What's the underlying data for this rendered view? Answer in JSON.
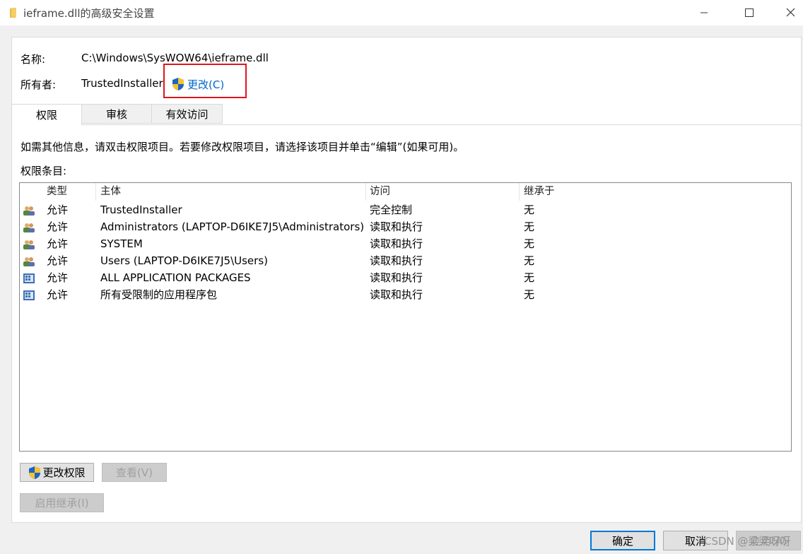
{
  "window": {
    "title": "ieframe.dll的高级安全设置",
    "icons": {
      "title": "folder-icon",
      "minimize": "minimize-icon",
      "maximize": "maximize-icon",
      "close": "close-icon"
    }
  },
  "object": {
    "name_label": "名称:",
    "name_value": "C:\\Windows\\SysWOW64\\ieframe.dll",
    "owner_label": "所有者:",
    "owner_value": "TrustedInstaller",
    "change_owner_label": "更改(C)",
    "change_owner_icon": "uac-shield-icon"
  },
  "tabs": [
    {
      "label": "权限",
      "active": true
    },
    {
      "label": "审核",
      "active": false
    },
    {
      "label": "有效访问",
      "active": false
    }
  ],
  "description": "如需其他信息，请双击权限项目。若要修改权限项目，请选择该项目并单击“编辑”(如果可用)。",
  "entries_label": "权限条目:",
  "table": {
    "columns": [
      "类型",
      "主体",
      "访问",
      "继承于"
    ],
    "rows": [
      {
        "icon": "user-group-icon",
        "type": "允许",
        "principal": "TrustedInstaller",
        "access": "完全控制",
        "inherited": "无"
      },
      {
        "icon": "user-group-icon",
        "type": "允许",
        "principal": "Administrators (LAPTOP-D6IKE7J5\\Administrators)",
        "access": "读取和执行",
        "inherited": "无"
      },
      {
        "icon": "user-group-icon",
        "type": "允许",
        "principal": "SYSTEM",
        "access": "读取和执行",
        "inherited": "无"
      },
      {
        "icon": "user-group-icon",
        "type": "允许",
        "principal": "Users (LAPTOP-D6IKE7J5\\Users)",
        "access": "读取和执行",
        "inherited": "无"
      },
      {
        "icon": "app-package-icon",
        "type": "允许",
        "principal": "ALL APPLICATION PACKAGES",
        "access": "读取和执行",
        "inherited": "无"
      },
      {
        "icon": "app-package-icon",
        "type": "允许",
        "principal": "所有受限制的应用程序包",
        "access": "读取和执行",
        "inherited": "无"
      }
    ]
  },
  "buttons": {
    "change_permissions": "更改权限",
    "view": "查看(V)",
    "enable_inheritance": "启用继承(I)",
    "ok": "确定",
    "cancel": "取消",
    "apply": "应用(A)"
  },
  "watermark": "CSDN @梁梁呀呀",
  "colors": {
    "link": "#0066cc",
    "highlight": "#e0161b",
    "default_button_border": "#0078d7"
  }
}
